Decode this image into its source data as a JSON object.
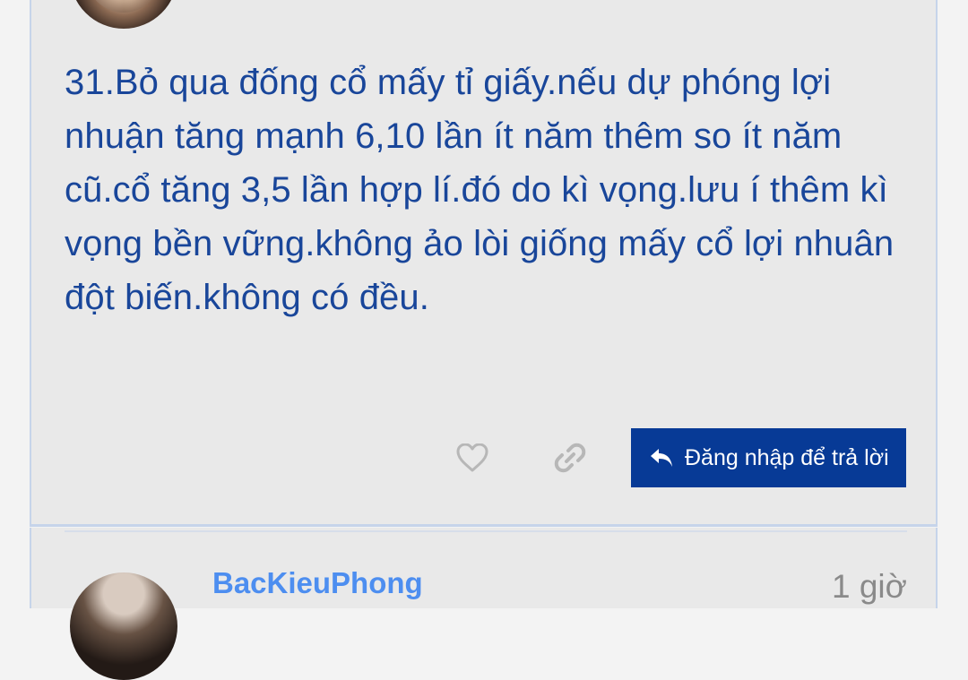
{
  "post": {
    "text": "31.Bỏ qua đống cổ mấy tỉ giấy.nếu dự phóng lợi nhuận tăng mạnh 6,10 lần ít năm thêm so ít năm cũ.cổ tăng 3,5 lần hợp lí.đó do kì vọng.lưu í thêm kì vọng bền vững.không ảo lòi giống mấy cổ lợi nhuân đột biến.không có đều.",
    "actions": {
      "like_icon": "heart-outline-icon",
      "link_icon": "link-icon",
      "reply_label": "Đăng nhập để trả lời",
      "reply_icon": "reply-arrow-icon"
    }
  },
  "next_post": {
    "author": "BacKieuPhong",
    "time": "1 giờ"
  },
  "colors": {
    "text_blue": "#19469a",
    "button_blue": "#073a96",
    "author_blue": "#4d8ef0",
    "card_bg": "#e9e9e9"
  }
}
